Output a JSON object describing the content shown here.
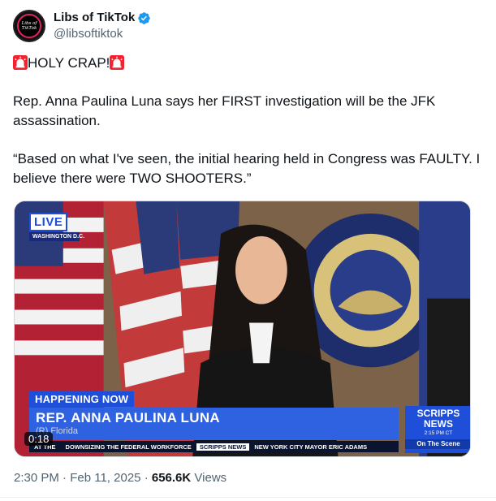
{
  "author": {
    "display_name": "Libs of TikTok",
    "handle": "@libsoftiktok",
    "avatar_text": [
      "Libs of",
      "TikTok"
    ],
    "verified_color": "#1d9bf0"
  },
  "post": {
    "line1": "HOLY CRAP!",
    "line2": "Rep. Anna Paulina Luna says her FIRST investigation will be the JFK assassination.",
    "line3": "“Based on what I've seen, the initial hearing held in Congress was FAULTY. I believe there were TWO SHOOTERS.”",
    "emoji": "siren-icon"
  },
  "video": {
    "live_label": "LIVE",
    "location": "WASHINGTON D.C.",
    "happening": "HAPPENING NOW",
    "guest_name": "REP. ANNA PAULINA LUNA",
    "guest_sub": "(R) Florida",
    "brand_line1": "SCRIPPS",
    "brand_line2": "NEWS",
    "brand_time": "2:15 PM CT",
    "brand_show": "On The Scene",
    "ticker_items": [
      "AT THE",
      "DOWNSIZING THE FEDERAL WORKFORCE",
      "NEW YORK CITY MAYOR ERIC ADAMS"
    ],
    "ticker_tag": "SCRIPPS NEWS",
    "duration": "0:18",
    "seal_text": "U.S. HOUSE OF REPRESENTATIVES"
  },
  "footer": {
    "time": "2:30 PM",
    "sep": "·",
    "date": "Feb 11, 2025",
    "views": "656.6K",
    "views_label": "Views"
  }
}
